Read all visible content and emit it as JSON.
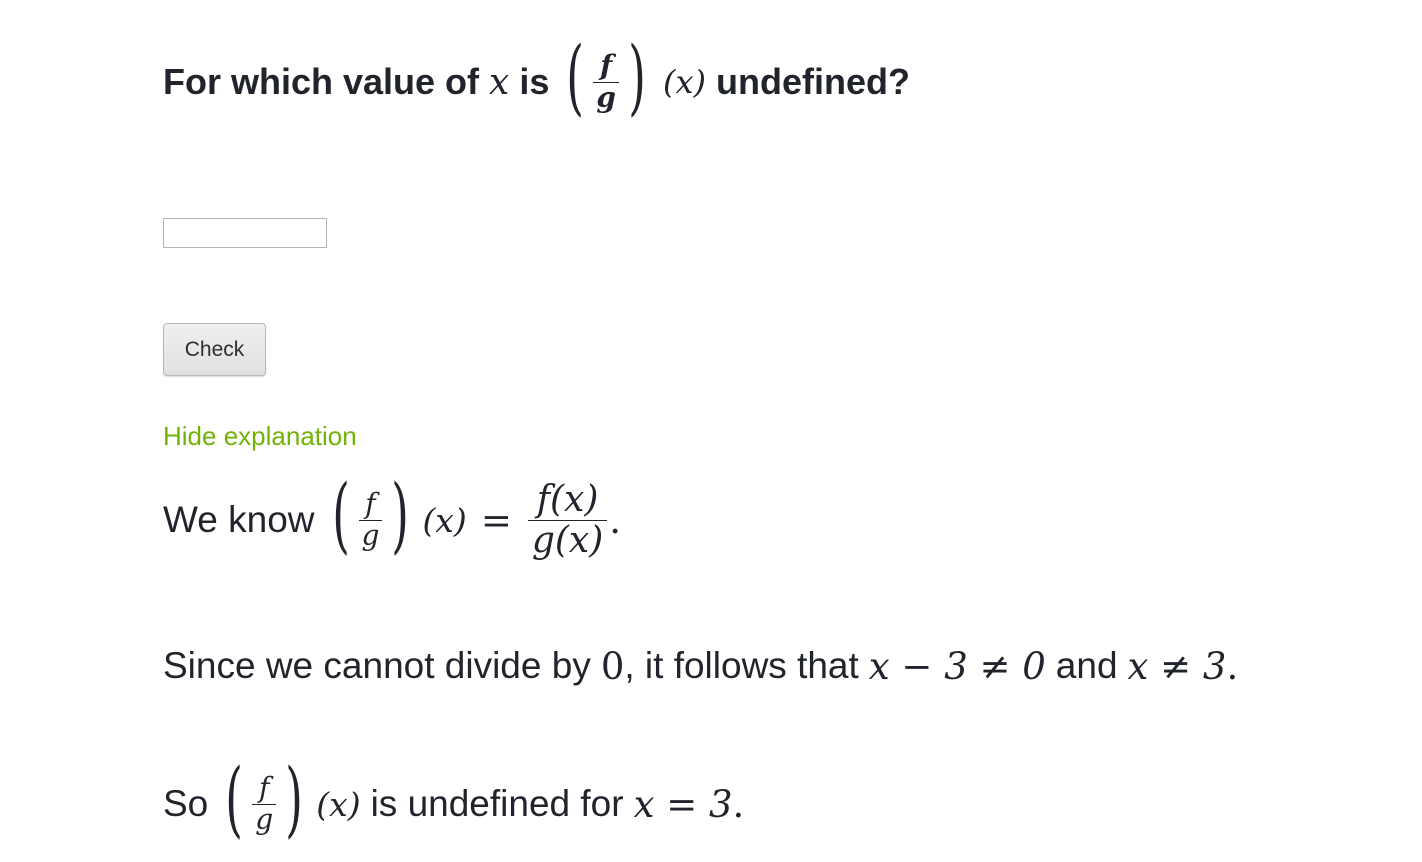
{
  "question": {
    "prefix": "For which value of",
    "var": "x",
    "is": "is",
    "frac_num": "f",
    "frac_den": "g",
    "arg": "(x)",
    "suffix": "undefined?"
  },
  "answer_input": {
    "value": "",
    "placeholder": ""
  },
  "check_button": {
    "label": "Check"
  },
  "explanation_toggle": {
    "label": "Hide explanation",
    "color": "#71b307"
  },
  "explanation": {
    "line1": {
      "prefix": "We know",
      "frac_num": "f",
      "frac_den": "g",
      "arg": "(x)",
      "equals": "=",
      "rhs_num": "f(x)",
      "rhs_den": "g(x)",
      "end": "."
    },
    "line2": {
      "prefix": "Since we cannot divide by",
      "zero": "0",
      "middle": ", it follows that",
      "expr1": "x − 3 ≠ 0",
      "and": "and",
      "expr2": "x ≠ 3",
      "end": "."
    },
    "line3": {
      "prefix": "So",
      "frac_num": "f",
      "frac_den": "g",
      "arg": "(x)",
      "middle": "is undefined for",
      "expr": "x = 3",
      "end": "."
    }
  }
}
